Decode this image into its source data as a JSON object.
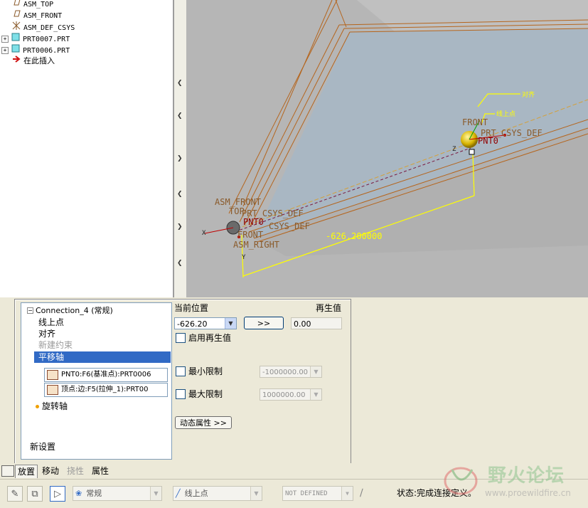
{
  "tree": {
    "items": [
      {
        "label": "ASM_TOP",
        "icon": "datum-plane-icon",
        "expander": ""
      },
      {
        "label": "ASM_FRONT",
        "icon": "datum-plane-icon",
        "expander": ""
      },
      {
        "label": "ASM_DEF_CSYS",
        "icon": "csys-icon",
        "expander": ""
      },
      {
        "label": "PRT0007.PRT",
        "icon": "part-icon",
        "expander": "+"
      },
      {
        "label": "PRT0006.PRT",
        "icon": "part-icon",
        "expander": "+"
      },
      {
        "label": "在此插入",
        "icon": "insert-arrow-icon",
        "expander": ""
      }
    ]
  },
  "viewport": {
    "labels": {
      "align": "对齐",
      "point_on_line": "线上点",
      "front_right": "FRONT",
      "prt_csys_right": "PRT_CSYS_DEF",
      "pnt0_right": "PNT0",
      "asm_front": "ASM_FRONT",
      "top_left": "TOP",
      "prt_csys_left": "PRT_CSYS_DEF",
      "pnt0_left": "PNT0",
      "csys_left": "CSYS_DEF",
      "front_left": "FRONT",
      "asm_right": "ASM_RIGHT",
      "dimension": "-626.200000",
      "x": "X",
      "y": "Y",
      "z": "Z"
    }
  },
  "panel": {
    "connection_title": "Connection_4 (常规)",
    "constraints": [
      {
        "label": "线上点",
        "state": "normal"
      },
      {
        "label": "对齐",
        "state": "normal"
      },
      {
        "label": "新建约束",
        "state": "disabled"
      },
      {
        "label": "平移轴",
        "state": "selected"
      }
    ],
    "references": [
      "PNT0:F6(基准点):PRT0006",
      "顶点:边:F5(拉伸_1):PRT00"
    ],
    "rotation_axis": "旋转轴",
    "new_set": "新设置",
    "current_position_label": "当前位置",
    "regen_value_label": "再生值",
    "current_position_value": "-626.20",
    "arrow_button": ">>",
    "regen_value": "0.00",
    "enable_regen_label": "启用再生值",
    "min_limit_label": "最小限制",
    "min_limit_value": "-1000000.00",
    "max_limit_label": "最大限制",
    "max_limit_value": "1000000.00",
    "dynamic_props_button": "动态属性 >>"
  },
  "tabs": [
    {
      "label": "放置",
      "active": true
    },
    {
      "label": "移动",
      "active": false
    },
    {
      "label": "挠性",
      "active": false,
      "disabled": true
    },
    {
      "label": "属性",
      "active": false
    }
  ],
  "toolbar": {
    "connection_type": "常规",
    "constraint_type": "线上点",
    "offset_value": "NOT DEFINED",
    "status": "状态:完成连接定义。",
    "watermark_title": "野火论坛",
    "watermark_url": "www.proewildfire.cn"
  },
  "colors": {
    "model_edge": "#b5651d",
    "annotation_yellow": "#ffff00",
    "surface": "#a9b7c3",
    "selection": "#316ac5"
  }
}
